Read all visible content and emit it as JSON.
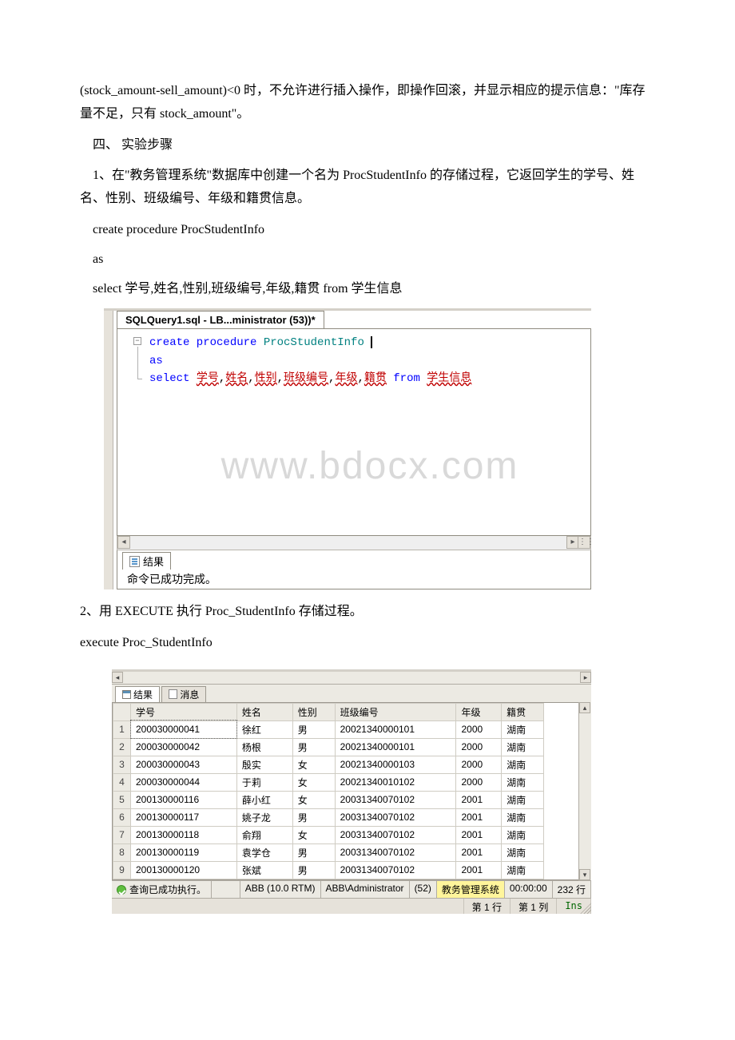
{
  "para1": "(stock_amount-sell_amount)<0 时，不允许进行插入操作，即操作回滚，并显示相应的提示信息：\"库存量不足，只有 stock_amount\"。",
  "heading4": "四、 实验步骤",
  "para2": "1、在\"教务管理系统\"数据库中创建一个名为 ProcStudentInfo 的存储过程，它返回学生的学号、姓名、性别、班级编号、年级和籍贯信息。",
  "code1_l1": "create procedure ProcStudentInfo",
  "code1_l2": "as",
  "code1_l3": "select 学号,姓名,性别,班级编号,年级,籍贯 from 学生信息",
  "sql": {
    "tab_title": "SQLQuery1.sql - LB...ministrator (53))*",
    "line1_kw": "create procedure",
    "line1_id": "ProcStudentInfo",
    "line2_kw": "as",
    "line3_kw_select": "select",
    "line3_kw_from": "from",
    "ident": {
      "c1": "学号",
      "c2": "姓名",
      "c3": "性别",
      "c4": "班级编号",
      "c5": "年级",
      "c6": "籍贯",
      "table": "学生信息"
    },
    "result_tab": "结果",
    "result_msg": "命令已成功完成。",
    "watermark": "www.bdocx.com"
  },
  "para3": "2、用 EXECUTE 执行 Proc_StudentInfo 存储过程。",
  "code2_l1": "execute Proc_StudentInfo",
  "grid": {
    "tabs": {
      "results": "结果",
      "messages": "消息"
    },
    "headers": {
      "h1": "学号",
      "h2": "姓名",
      "h3": "性别",
      "h4": "班级编号",
      "h5": "年级",
      "h6": "籍贯"
    },
    "rows": [
      {
        "n": "1",
        "id": "200030000041",
        "name": "徐红",
        "sex": "男",
        "cls": "20021340000101",
        "grade": "2000",
        "place": "湖南"
      },
      {
        "n": "2",
        "id": "200030000042",
        "name": "杨根",
        "sex": "男",
        "cls": "20021340000101",
        "grade": "2000",
        "place": "湖南"
      },
      {
        "n": "3",
        "id": "200030000043",
        "name": "殷实",
        "sex": "女",
        "cls": "20021340000103",
        "grade": "2000",
        "place": "湖南"
      },
      {
        "n": "4",
        "id": "200030000044",
        "name": "于莉",
        "sex": "女",
        "cls": "20021340010102",
        "grade": "2000",
        "place": "湖南"
      },
      {
        "n": "5",
        "id": "200130000116",
        "name": "薛小红",
        "sex": "女",
        "cls": "20031340070102",
        "grade": "2001",
        "place": "湖南"
      },
      {
        "n": "6",
        "id": "200130000117",
        "name": "姚子龙",
        "sex": "男",
        "cls": "20031340070102",
        "grade": "2001",
        "place": "湖南"
      },
      {
        "n": "7",
        "id": "200130000118",
        "name": "俞翔",
        "sex": "女",
        "cls": "20031340070102",
        "grade": "2001",
        "place": "湖南"
      },
      {
        "n": "8",
        "id": "200130000119",
        "name": "袁学仓",
        "sex": "男",
        "cls": "20031340070102",
        "grade": "2001",
        "place": "湖南"
      },
      {
        "n": "9",
        "id": "200130000120",
        "name": "张斌",
        "sex": "男",
        "cls": "20031340070102",
        "grade": "2001",
        "place": "湖南"
      }
    ],
    "status1": {
      "ok": "查询已成功执行。",
      "server": "ABB (10.0 RTM)",
      "user": "ABB\\Administrator",
      "spid": "(52)",
      "db": "教务管理系统",
      "time": "00:00:00",
      "rows": "232 行"
    },
    "status2": {
      "row": "第 1 行",
      "col": "第 1 列",
      "ins": "Ins"
    }
  }
}
